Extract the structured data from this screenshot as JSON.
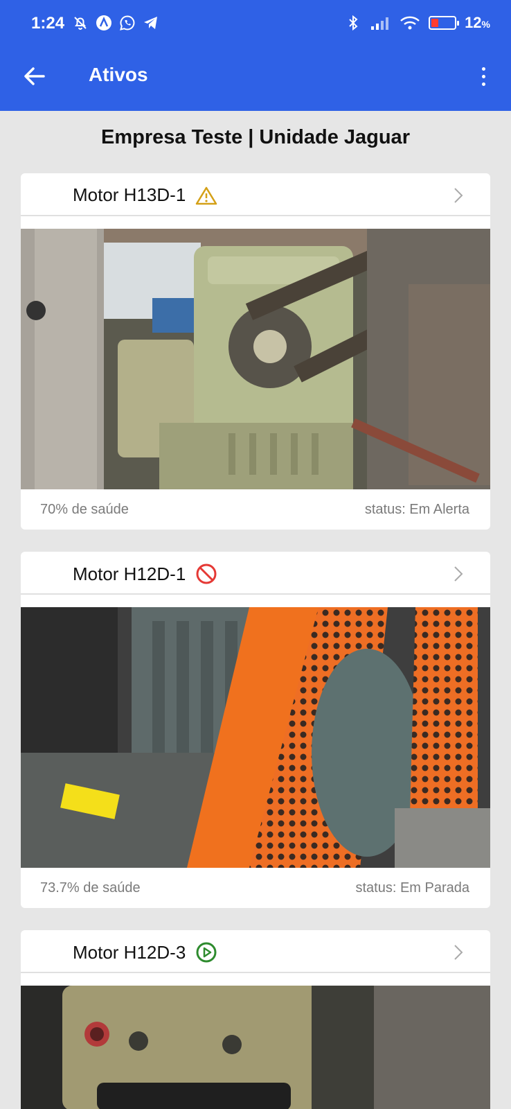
{
  "statusbar": {
    "time": "1:24",
    "battery_percent": "12",
    "battery_level": 0.12,
    "battery_pct_sign": "%",
    "icons": [
      "mute-icon",
      "a-app-icon",
      "whatsapp-icon",
      "telegram-icon",
      "bluetooth-icon",
      "signal-icon",
      "wifi-icon",
      "battery-icon"
    ]
  },
  "appbar": {
    "title": "Ativos",
    "back_icon": "arrow-left-icon",
    "menu_icon": "more-vertical-icon"
  },
  "company_header": "Empresa Teste | Unidade Jaguar",
  "assets": [
    {
      "name": "Motor H13D-1",
      "status_icon": "warning-icon",
      "status_color": "#d4a017",
      "health": "70% de saúde",
      "status": "status: Em Alerta",
      "image": "green-gear-reducer-with-chain-photo"
    },
    {
      "name": "Motor H12D-1",
      "status_icon": "stop-icon",
      "status_color": "#e53935",
      "health": "73.7% de saúde",
      "status": "status: Em Parada",
      "image": "motor-with-orange-perforated-guard-photo"
    },
    {
      "name": "Motor H12D-3",
      "status_icon": "play-icon",
      "status_color": "#2e8b2e",
      "image": "yellowish-motor-housing-photo"
    }
  ],
  "colors": {
    "primary": "#2f61e6",
    "background": "#e6e6e6",
    "card": "#ffffff"
  }
}
